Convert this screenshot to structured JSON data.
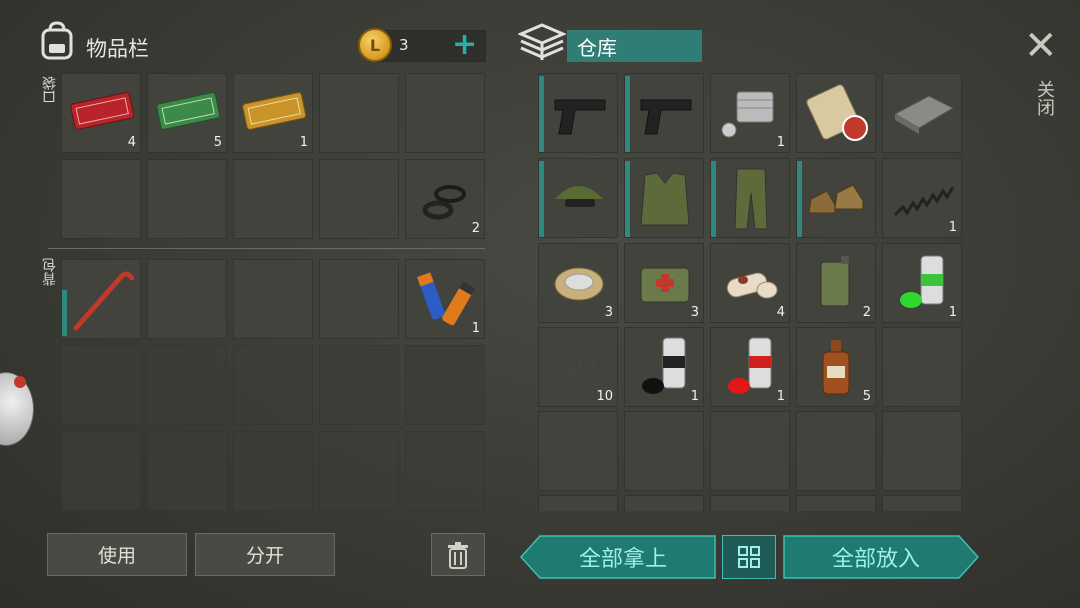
{
  "inventory": {
    "title": "物品栏",
    "coins": "3",
    "coin_symbol": "L",
    "pocket_label": "口袋",
    "backpack_label": "背包",
    "pocket_counts": [
      "4",
      "5",
      "1",
      "",
      "",
      "",
      "",
      "",
      "",
      "2"
    ],
    "backpack_counts": [
      "",
      "",
      "",
      "",
      "1"
    ]
  },
  "warehouse": {
    "title": "仓库",
    "counts": [
      "",
      "",
      "1",
      "",
      "",
      "",
      "",
      "",
      "",
      "1",
      "3",
      "3",
      "4",
      "2",
      "1",
      "10",
      "1",
      "1",
      "5",
      ""
    ]
  },
  "buttons": {
    "use": "使用",
    "split": "分开",
    "take_all": "全部拿上",
    "put_all": "全部放入"
  },
  "close": {
    "icon": "×",
    "label": "关闭"
  },
  "colors": {
    "accent": "#24b3a6",
    "teal_dark": "#2f7d75",
    "slot_bg": "#43433e"
  }
}
